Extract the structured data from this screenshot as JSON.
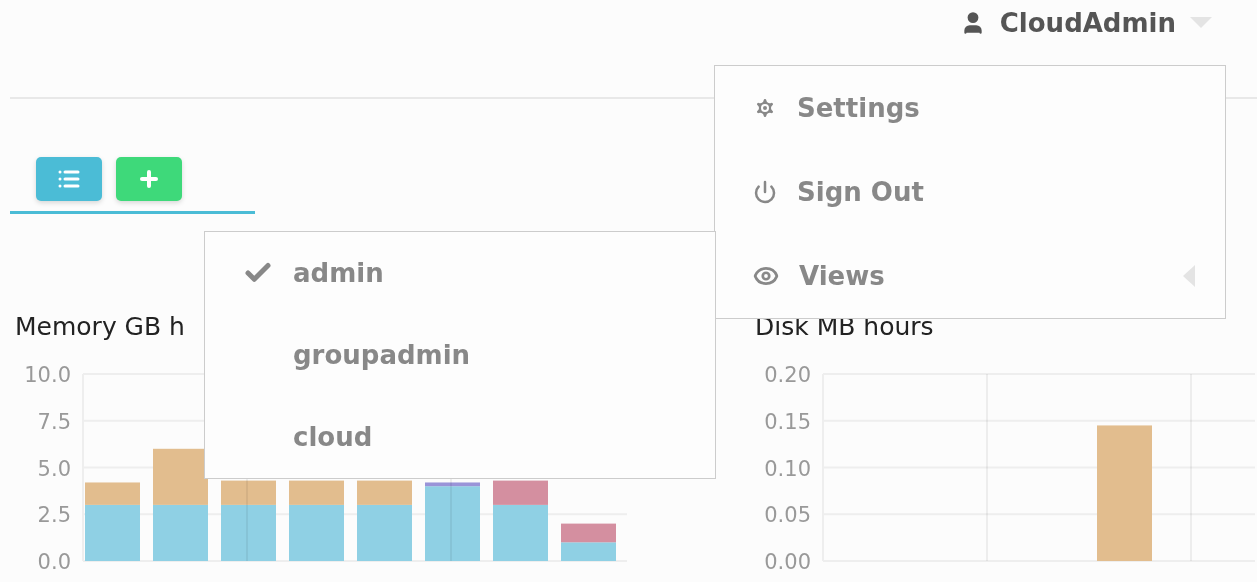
{
  "header": {
    "user": "CloudAdmin"
  },
  "user_menu": {
    "items": [
      {
        "kind": "settings",
        "label": "Settings",
        "submenu": false
      },
      {
        "kind": "signout",
        "label": "Sign Out",
        "submenu": false
      },
      {
        "kind": "views",
        "label": "Views",
        "submenu": true
      }
    ]
  },
  "views_menu": {
    "items": [
      {
        "label": "admin",
        "selected": true
      },
      {
        "label": "groupadmin",
        "selected": false
      },
      {
        "label": "cloud",
        "selected": false
      }
    ]
  },
  "charts": [
    {
      "title": "Memory GB h",
      "chart_data": {
        "type": "bar",
        "stacked": true,
        "grid": true,
        "ylim": [
          0,
          10
        ],
        "yticks": [
          {
            "value": 0,
            "label": "0.0"
          },
          {
            "value": 2.5,
            "label": "2.5"
          },
          {
            "value": 5,
            "label": "5.0"
          },
          {
            "value": 7.5,
            "label": "7.5"
          },
          {
            "value": 10,
            "label": "10.0"
          }
        ],
        "series": [
          {
            "color": "#8fd0e4",
            "values": [
              3,
              3,
              3,
              3,
              3,
              4,
              3,
              1
            ]
          },
          {
            "color": "#e2bd8e",
            "values": [
              1.2,
              3,
              1.3,
              1.3,
              1.3,
              null,
              null,
              null
            ]
          },
          {
            "color": "#d48fa0",
            "values": [
              null,
              null,
              null,
              null,
              null,
              null,
              1.3,
              1
            ]
          },
          {
            "color": "#9a94d8",
            "values": [
              null,
              null,
              null,
              null,
              null,
              0.2,
              null,
              null
            ]
          }
        ]
      }
    },
    {
      "title": "Disk MB hours",
      "chart_data": {
        "type": "bar",
        "stacked": true,
        "grid": true,
        "ylim": [
          0,
          0.2
        ],
        "yticks": [
          {
            "value": 0,
            "label": "0.00"
          },
          {
            "value": 0.05,
            "label": "0.05"
          },
          {
            "value": 0.1,
            "label": "0.10"
          },
          {
            "value": 0.15,
            "label": "0.15"
          },
          {
            "value": 0.2,
            "label": "0.20"
          }
        ],
        "series": [
          {
            "color": "#e2bd8e",
            "values": [
              null,
              null,
              null,
              null,
              0.145,
              null,
              null
            ]
          }
        ]
      }
    }
  ]
}
